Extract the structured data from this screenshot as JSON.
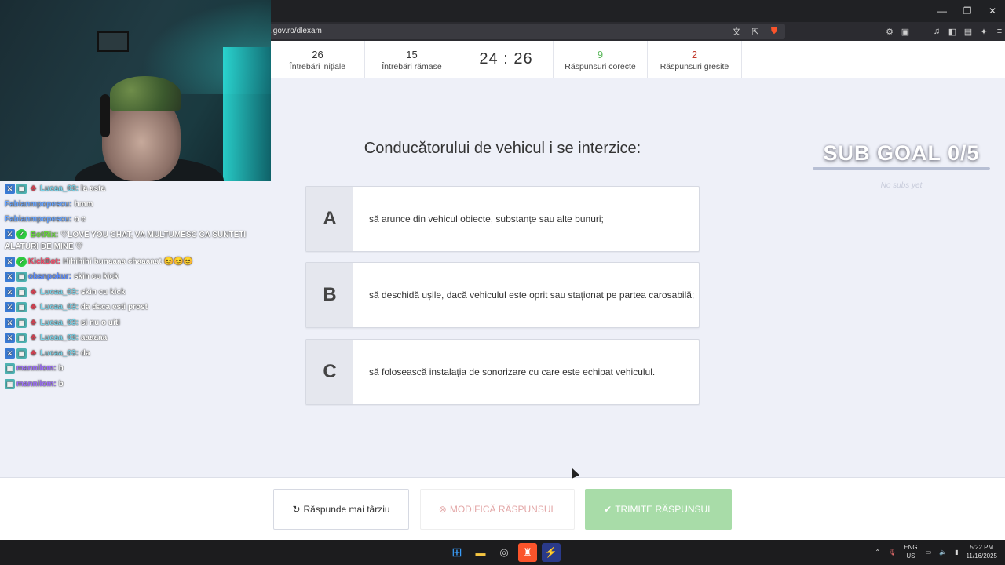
{
  "browser": {
    "url": ".gov.ro/dlexam",
    "window_controls": [
      "—",
      "❐",
      "✕"
    ]
  },
  "stats": {
    "initial": {
      "value": "26",
      "label": "Întrebări inițiale"
    },
    "remaining": {
      "value": "15",
      "label": "Întrebări rămase"
    },
    "timer": "24 : 26",
    "correct": {
      "value": "9",
      "label": "Răspunsuri corecte"
    },
    "wrong": {
      "value": "2",
      "label": "Răspunsuri greșite"
    }
  },
  "question": "Conducătorului de vehicul i se interzice:",
  "answers": [
    {
      "letter": "A",
      "text": "să arunce din vehicul obiecte, substanțe sau alte bunuri;"
    },
    {
      "letter": "B",
      "text": "să deschidă ușile, dacă vehiculul este oprit sau staționat pe partea carosabilă;"
    },
    {
      "letter": "C",
      "text": "să folosească instalația de sonorizare cu care este echipat vehiculul."
    }
  ],
  "buttons": {
    "later": "Răspunde mai târziu",
    "modify": "MODIFICĂ RĂSPUNSUL",
    "send": "TRIMITE RĂSPUNSUL"
  },
  "overlay": {
    "sub_goal_title": "SUB GOAL 0/5",
    "sub_goal_sub": "No subs yet"
  },
  "chat": [
    {
      "user": "Lucaa_03:",
      "text": "la asta"
    },
    {
      "user": "Fabianmpopescu:",
      "text": "hmm"
    },
    {
      "user": "Fabianmpopescu:",
      "text": "o c"
    },
    {
      "user": "BotRix:",
      "text": "♡LOVE YOU CHAT, VA MULTUMESC CA SUNTETI ALATURI DE MINE ♡"
    },
    {
      "user": "KickBot:",
      "text": "Hihihihi bunaaaa chaaaaat 😊😊😊"
    },
    {
      "user": "obsnpokur:",
      "text": "skin cu kick"
    },
    {
      "user": "Lucaa_03:",
      "text": "skin cu kick"
    },
    {
      "user": "Lucaa_03:",
      "text": "da daca esti prost"
    },
    {
      "user": "Lucaa_03:",
      "text": "si nu o uiti"
    },
    {
      "user": "Lucaa_03:",
      "text": "aaaaaa"
    },
    {
      "user": "Lucaa_03:",
      "text": "da"
    },
    {
      "user": "mannilom:",
      "text": "b"
    },
    {
      "user": "mannilom:",
      "text": "b"
    }
  ],
  "taskbar": {
    "lang_top": "ENG",
    "lang_bottom": "US",
    "time": "5:22 PM",
    "date": "11/16/2025"
  },
  "colors": {
    "correct": "#5cb85c",
    "wrong": "#c0392b",
    "send_button": "#a8dca8",
    "page_bg": "#eef0f8"
  }
}
